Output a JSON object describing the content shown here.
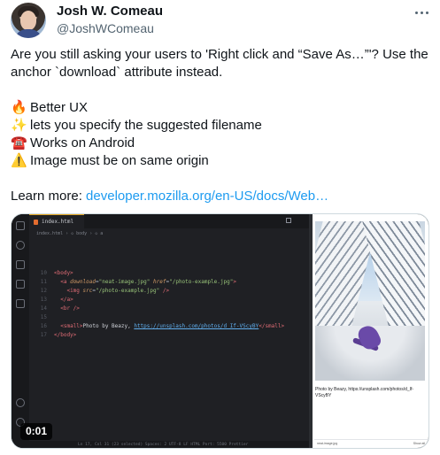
{
  "author": {
    "name": "Josh W. Comeau",
    "handle": "@JoshWComeau"
  },
  "tweet": {
    "line1": "Are you still asking your users to 'Right click and “Save As…”'? Use the",
    "line2": "anchor `download` attribute instead.",
    "bullets": [
      {
        "emoji": "🔥",
        "text": "Better UX"
      },
      {
        "emoji": "✨",
        "text": "lets you specify the suggested filename"
      },
      {
        "emoji": "☎️",
        "text": "Works on Android"
      },
      {
        "emoji": "⚠️",
        "text": "Image must be on same origin"
      }
    ],
    "learn_more_label": "Learn more: ",
    "learn_more_link": "developer.mozilla.org/en-US/docs/Web…"
  },
  "video": {
    "duration": "0:01",
    "editor": {
      "tab_label": "index.html",
      "breadcrumbs": "index.html › ◇ body › ◇ a",
      "code_lines": [
        {
          "num": "10",
          "indent": "",
          "parts": [
            [
              "tag",
              "<body>"
            ]
          ]
        },
        {
          "num": "11",
          "indent": "  ",
          "parts": [
            [
              "tag",
              "<a "
            ],
            [
              "attr",
              "download"
            ],
            [
              "pun",
              "="
            ],
            [
              "str",
              "\"neat-image.jpg\""
            ],
            [
              "pun",
              " "
            ],
            [
              "attr",
              "href"
            ],
            [
              "pun",
              "="
            ],
            [
              "str",
              "\"/photo-example.jpg\""
            ],
            [
              "tag",
              ">"
            ]
          ]
        },
        {
          "num": "12",
          "indent": "    ",
          "parts": [
            [
              "tag",
              "<img "
            ],
            [
              "attr",
              "src"
            ],
            [
              "pun",
              "="
            ],
            [
              "str",
              "\"/photo-example.jpg\""
            ],
            [
              "tag",
              " />"
            ]
          ]
        },
        {
          "num": "13",
          "indent": "  ",
          "parts": [
            [
              "tag",
              "</a>"
            ]
          ]
        },
        {
          "num": "14",
          "indent": "  ",
          "parts": [
            [
              "tag",
              "<br />"
            ]
          ]
        },
        {
          "num": "15",
          "indent": "",
          "parts": []
        },
        {
          "num": "16",
          "indent": "  ",
          "parts": [
            [
              "tag",
              "<small>"
            ],
            [
              "plain",
              "Photo by Beazy, "
            ],
            [
              "url",
              "https://unsplash.com/photos/d_If-VScyBY"
            ],
            [
              "tag",
              "</small>"
            ]
          ]
        },
        {
          "num": "17",
          "indent": "",
          "parts": [
            [
              "tag",
              "</body>"
            ]
          ]
        }
      ],
      "status_text": "Ln 17, Col 31 (23 selected)   Spaces: 2   UTF-8   LF   HTML   Port: 5500   Prettier"
    },
    "preview": {
      "caption": "Photo by Beazy, https://unsplash.com/photos/d_If-VScyBY",
      "tab_left": "neat-image.jpg",
      "tab_right": "Show all"
    }
  },
  "colors": {
    "link": "#1d9bf0",
    "text": "#0f1419",
    "muted": "#536471"
  }
}
